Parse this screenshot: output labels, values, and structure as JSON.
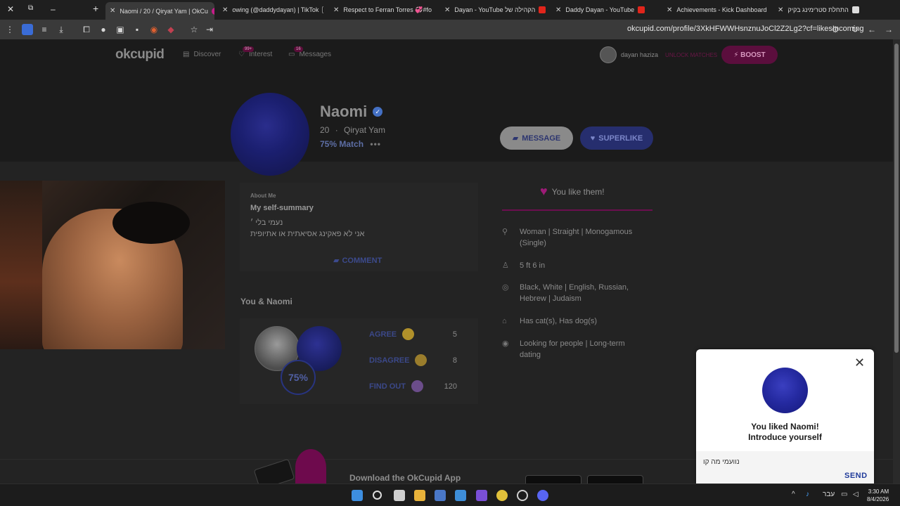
{
  "browser": {
    "tabs": [
      {
        "title": "Naomi / 20 / Qiryat Yam | OkCu",
        "active": true
      },
      {
        "title": "owing (@daddydayan) | TikTok",
        "active": false
      },
      {
        "title": "Respect to Ferran Torres 💞#fo",
        "active": false
      },
      {
        "title": "Dayan - YouTube הקהילה של",
        "active": false
      },
      {
        "title": "Daddy Dayan - YouTube",
        "active": false
      },
      {
        "title": "Achievements - Kick Dashboard",
        "active": false
      },
      {
        "title": "התחלת סטרימינג בקיק",
        "active": false
      }
    ],
    "url": "okcupid.com/profile/3XkHFWWHsnznuJoCl2Z2Lg2?cf=likesIncoming",
    "colors": {
      "tab_active": "#3a3a3a",
      "tab_bar": "#1f1f1f"
    }
  },
  "nav": {
    "logo": "okcupid",
    "discover": "Discover",
    "interest": "Interest",
    "interest_badge": "99+",
    "messages": "Messages",
    "messages_badge": "16",
    "user_name": "dayan haziza",
    "upgrade": "UNLOCK MATCHES",
    "boost": "⚡ BOOST"
  },
  "profile": {
    "name": "Naomi",
    "age": "20",
    "city": "Qiryat Yam",
    "match": "75% Match",
    "message_btn": "MESSAGE",
    "superlike_btn": "SUPERLIKE"
  },
  "about": {
    "label": "About Me",
    "title": "My self-summary",
    "lines": [
      "נעמי בלי ׳",
      "אני לא פאקינג אסיאתית או אתיופית"
    ],
    "comment_btn": "COMMENT"
  },
  "you_section": {
    "title": "You & Naomi",
    "percent": "75%",
    "rows": [
      {
        "label": "AGREE",
        "count": "5",
        "emoji_color": "#b0902a"
      },
      {
        "label": "DISAGREE",
        "count": "8",
        "emoji_color": "#9a7d2c"
      },
      {
        "label": "FIND OUT",
        "count": "120",
        "emoji_color": "#6b4d8a"
      }
    ]
  },
  "likes": {
    "liked_text": "You like them!"
  },
  "details": [
    {
      "icon": "gender-icon",
      "text": "Woman | Straight | Monogamous (Single)"
    },
    {
      "icon": "height-icon",
      "text": "5 ft 6 in"
    },
    {
      "icon": "globe-icon",
      "text": "Black, White | English, Russian, Hebrew | Judaism"
    },
    {
      "icon": "pets-icon",
      "text": "Has cat(s), Has dog(s)"
    },
    {
      "icon": "eye-icon",
      "text": "Looking for people | Long-term dating"
    }
  ],
  "app_promo": {
    "title": "Download the OkCupid App"
  },
  "popup": {
    "title_line1": "You liked Naomi!",
    "title_line2": "Introduce yourself",
    "input_value": "נוועמי מה קו",
    "send": "SEND",
    "close": "✕"
  },
  "taskbar": {
    "lang": "עבר",
    "time": "3:30 AM",
    "date": "8/4/2026"
  }
}
